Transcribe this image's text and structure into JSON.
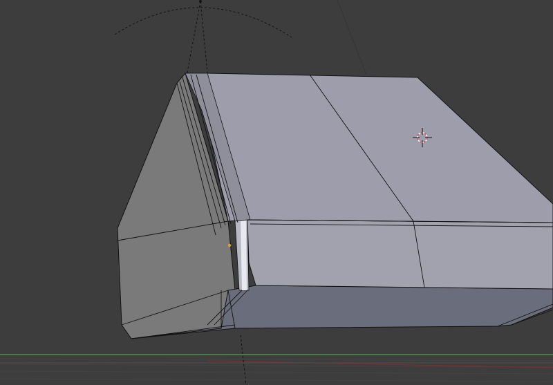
{
  "viewport": {
    "mode": "edit-mode-wireframe-overlay",
    "background_color": "#3d3d3d",
    "mesh": {
      "top_face_color": "#9d9dab",
      "front_face_color": "#a2a2af",
      "left_face_color": "#7a7a7a",
      "bottom_face_color": "#6a6d7c",
      "edge_color": "#111111",
      "selected_vertex_color": "#e0a030"
    },
    "grid": {
      "x_axis_color": "#8a2a2a",
      "y_axis_color": "#4a7a4a",
      "grid_color": "#474747"
    },
    "camera_indicator_color": "#111111",
    "cursor_3d_colors": [
      "#e05050",
      "#ffffff"
    ]
  }
}
